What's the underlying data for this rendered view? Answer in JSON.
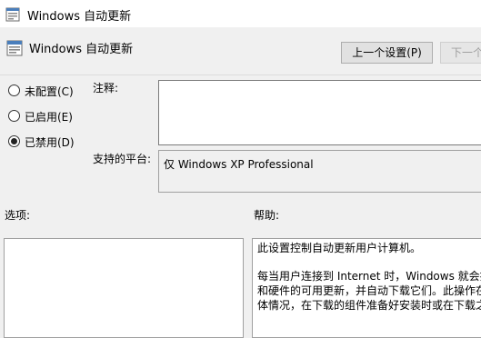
{
  "window": {
    "title": "Windows 自动更新",
    "icon": "group-policy-setting-icon"
  },
  "header": {
    "policy_title": "Windows 自动更新",
    "prev_button": "上一个设置(P)",
    "next_button": "下一个"
  },
  "state_options": [
    {
      "label": "未配置(C)",
      "selected": false
    },
    {
      "label": "已启用(E)",
      "selected": false
    },
    {
      "label": "已禁用(D)",
      "selected": true
    }
  ],
  "comment": {
    "label": "注释:",
    "value": ""
  },
  "platform": {
    "label": "支持的平台:",
    "value": "仅 Windows XP Professional"
  },
  "options": {
    "label": "选项:"
  },
  "help": {
    "label": "帮助:",
    "lines": [
      "此设置控制自动更新用户计算机。",
      "每当用户连接到 Internet 时，Windows 就会搜",
      "和硬件的可用更新，并自动下载它们。此操作在",
      "体情况，在下载的组件准备好安装时或在下载之"
    ]
  },
  "colors": {
    "window_bg": "#f0f0f0",
    "titlebar_bg": "#ffffff",
    "button_bg": "#e1e1e1"
  }
}
